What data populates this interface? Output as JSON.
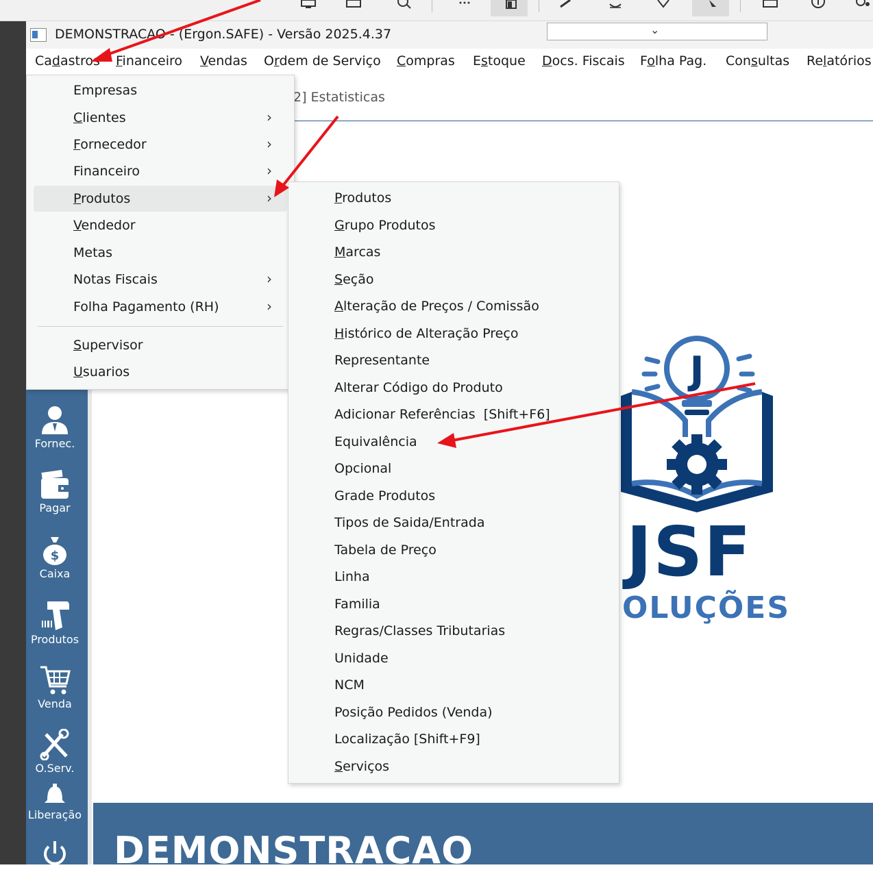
{
  "window": {
    "title": "DEMONSTRACAO - (Ergon.SAFE) - Versão 2025.4.37",
    "combo_arrow": "⌄"
  },
  "menubar": {
    "items": [
      {
        "pre": "Ca",
        "u": "d",
        "post": "astros"
      },
      {
        "pre": "",
        "u": "F",
        "post": "inanceiro"
      },
      {
        "pre": "",
        "u": "V",
        "post": "endas"
      },
      {
        "pre": "O",
        "u": "r",
        "post": "dem de Serviço"
      },
      {
        "pre": "",
        "u": "C",
        "post": "ompras"
      },
      {
        "pre": "E",
        "u": "s",
        "post": "toque"
      },
      {
        "pre": "",
        "u": "D",
        "post": "ocs. Fiscais"
      },
      {
        "pre": "F",
        "u": "o",
        "post": "lha Pag."
      },
      {
        "pre": "Con",
        "u": "s",
        "post": "ultas"
      },
      {
        "pre": "Re",
        "u": "l",
        "post": "atórios"
      }
    ]
  },
  "workspace": {
    "tab_label": "2] Estatisticas",
    "bottom_title": "DEMONSTRACAO"
  },
  "sidebar": {
    "items": [
      {
        "label": "Fornec.",
        "icon": "person-icon"
      },
      {
        "label": "Pagar",
        "icon": "wallet-icon"
      },
      {
        "label": "Caixa",
        "icon": "money-bag-icon"
      },
      {
        "label": "Produtos",
        "icon": "barcode-scanner-icon"
      },
      {
        "label": "Venda",
        "icon": "cart-icon"
      },
      {
        "label": "O.Serv.",
        "icon": "tools-icon"
      },
      {
        "label": "Liberação",
        "icon": "bell-icon"
      },
      {
        "label": "",
        "icon": "power-icon"
      }
    ]
  },
  "cadastros_menu": {
    "items": [
      {
        "pre": "",
        "u": "",
        "post": "Empresas",
        "submenu": false
      },
      {
        "pre": "",
        "u": "C",
        "post": "lientes",
        "submenu": true
      },
      {
        "pre": "",
        "u": "F",
        "post": "ornecedor",
        "submenu": true
      },
      {
        "pre": "",
        "u": "",
        "post": "Financeiro",
        "submenu": true
      },
      {
        "pre": "",
        "u": "P",
        "post": "rodutos",
        "submenu": true
      },
      {
        "pre": "",
        "u": "V",
        "post": "endedor",
        "submenu": false
      },
      {
        "pre": "",
        "u": "",
        "post": "Metas",
        "submenu": false
      },
      {
        "pre": "",
        "u": "",
        "post": "Notas Fiscais",
        "submenu": true
      },
      {
        "pre": "",
        "u": "",
        "post": "Folha Pagamento (RH)",
        "submenu": true
      },
      {
        "pre": "",
        "u": "S",
        "post": "upervisor",
        "submenu": false
      },
      {
        "pre": "",
        "u": "U",
        "post": "suarios",
        "submenu": false
      }
    ],
    "chevron": "›"
  },
  "produtos_submenu": {
    "items": [
      {
        "pre": "",
        "u": "P",
        "post": "rodutos"
      },
      {
        "pre": "",
        "u": "G",
        "post": "rupo Produtos"
      },
      {
        "pre": "",
        "u": "M",
        "post": "arcas"
      },
      {
        "pre": "",
        "u": "S",
        "post": "eção"
      },
      {
        "pre": "",
        "u": "A",
        "post": "lteração de Preços / Comissão"
      },
      {
        "pre": "",
        "u": "H",
        "post": "istórico de Alteração Preço"
      },
      {
        "pre": "",
        "u": "",
        "post": "Representante"
      },
      {
        "pre": "",
        "u": "",
        "post": "Alterar Código do Produto"
      },
      {
        "pre": "",
        "u": "",
        "post": "Adicionar Referências  [Shift+F6]"
      },
      {
        "pre": "",
        "u": "",
        "post": "Equivalência"
      },
      {
        "pre": "",
        "u": "",
        "post": "Opcional"
      },
      {
        "pre": "",
        "u": "",
        "post": "Grade Produtos"
      },
      {
        "pre": "",
        "u": "",
        "post": "Tipos de Saida/Entrada"
      },
      {
        "pre": "",
        "u": "",
        "post": "Tabela de Preço"
      },
      {
        "pre": "",
        "u": "",
        "post": "Linha"
      },
      {
        "pre": "",
        "u": "",
        "post": "Familia"
      },
      {
        "pre": "",
        "u": "",
        "post": "Regras/Classes Tributarias"
      },
      {
        "pre": "",
        "u": "",
        "post": "Unidade"
      },
      {
        "pre": "",
        "u": "",
        "post": "NCM"
      },
      {
        "pre": "",
        "u": "",
        "post": "Posição Pedidos (Venda)"
      },
      {
        "pre": "",
        "u": "",
        "post": "Localização [Shift+F9]"
      },
      {
        "pre": "",
        "u": "S",
        "post": "erviços"
      }
    ]
  },
  "logo": {
    "letter": "J",
    "brand": "JSF",
    "tagline": "OLUÇÕES",
    "colors": {
      "dark": "#0b3b72",
      "light": "#3c72b6"
    }
  },
  "colors": {
    "sidebar": "#3e6a95",
    "annotation_arrow": "#e8141b",
    "menu_bg": "#f6f8f7"
  }
}
